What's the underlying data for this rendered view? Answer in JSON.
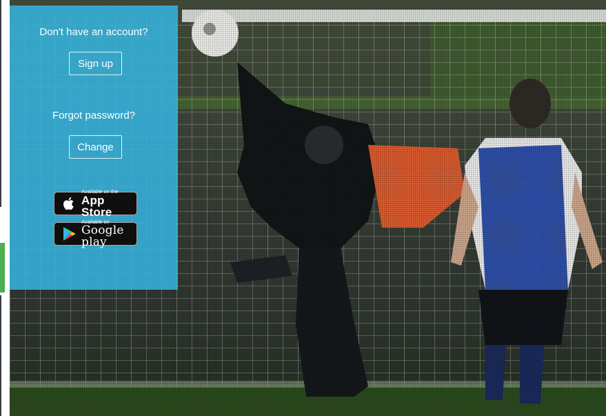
{
  "signup": {
    "prompt": "Don't have an account?",
    "button_label": "Sign up"
  },
  "password": {
    "prompt": "Forgot password?",
    "button_label": "Change"
  },
  "stores": {
    "apple": {
      "small": "Available on the",
      "big": "App Store"
    },
    "google": {
      "small": "Available on",
      "big": "Google play"
    }
  },
  "colors": {
    "panel": "#36b4e0",
    "green_tab": "#4caf50"
  }
}
